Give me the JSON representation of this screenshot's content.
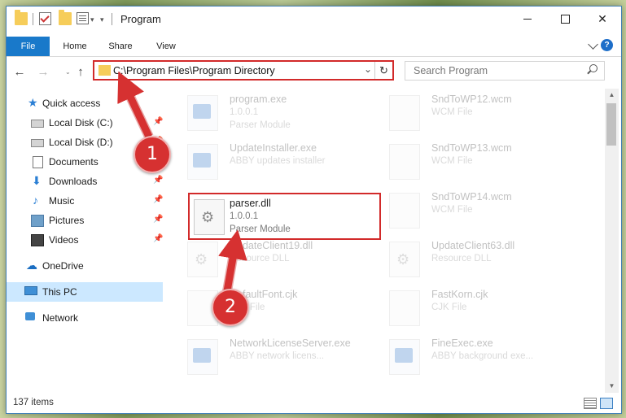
{
  "window": {
    "title": "Program"
  },
  "ribbon": {
    "tabs": [
      "File",
      "Home",
      "Share",
      "View"
    ],
    "help": "?"
  },
  "toolbar": {
    "back_icon": "←",
    "forward_icon": "→",
    "up_icon": "↑",
    "recent_icon": "⌄",
    "address": "C:\\Program Files\\Program Directory",
    "address_dropdown": "⌄",
    "refresh": "↻",
    "search_placeholder": "Search Program"
  },
  "window_controls": {
    "close": "✕"
  },
  "sidebar": {
    "items": [
      {
        "label": "Quick access",
        "icon": "star-icon",
        "glyph": "★",
        "pinned": false
      },
      {
        "label": "Local Disk (C:)",
        "icon": "drive-icon",
        "glyph": "",
        "pinned": true
      },
      {
        "label": "Local Disk (D:)",
        "icon": "drive-icon",
        "glyph": "",
        "pinned": true
      },
      {
        "label": "Documents",
        "icon": "documents-icon",
        "glyph": "",
        "pinned": true
      },
      {
        "label": "Downloads",
        "icon": "download-icon",
        "glyph": "⬇",
        "pinned": true
      },
      {
        "label": "Music",
        "icon": "music-icon",
        "glyph": "♪",
        "pinned": true
      },
      {
        "label": "Pictures",
        "icon": "pictures-icon",
        "glyph": "",
        "pinned": true
      },
      {
        "label": "Videos",
        "icon": "videos-icon",
        "glyph": "",
        "pinned": true
      },
      {
        "label": "OneDrive",
        "icon": "onedrive-icon",
        "glyph": "☁",
        "pinned": false
      },
      {
        "label": "This PC",
        "icon": "computer-icon",
        "glyph": "",
        "pinned": false,
        "selected": true
      },
      {
        "label": "Network",
        "icon": "network-icon",
        "glyph": "",
        "pinned": false
      }
    ],
    "pin_glyph": "📌"
  },
  "files": [
    {
      "name": "program.exe",
      "line1": "1.0.0.1",
      "line2": "Parser Module",
      "type": "exe",
      "faded": true
    },
    {
      "name": "SndToWP12.wcm",
      "line1": "WCM File",
      "line2": "",
      "type": "doc",
      "faded": true
    },
    {
      "name": "UpdateInstaller.exe",
      "line1": "ABBY updates installer",
      "line2": "",
      "type": "exe",
      "faded": true
    },
    {
      "name": "SndToWP13.wcm",
      "line1": "WCM File",
      "line2": "",
      "type": "doc",
      "faded": true
    },
    {
      "name": "parser.dll",
      "line1": "1.0.0.1",
      "line2": "Parser Module",
      "type": "dll",
      "faded": false
    },
    {
      "name": "SndToWP14.wcm",
      "line1": "WCM File",
      "line2": "",
      "type": "doc",
      "faded": true
    },
    {
      "name": "UpdateClient19.dll",
      "line1": "Resource DLL",
      "line2": "",
      "type": "dll",
      "faded": true
    },
    {
      "name": "UpdateClient63.dll",
      "line1": "Resource DLL",
      "line2": "",
      "type": "dll",
      "faded": true
    },
    {
      "name": "DefaultFont.cjk",
      "line1": "CJK File",
      "line2": "",
      "type": "doc",
      "faded": true
    },
    {
      "name": "FastKorn.cjk",
      "line1": "CJK File",
      "line2": "",
      "type": "doc",
      "faded": true
    },
    {
      "name": "NetworkLicenseServer.exe",
      "line1": "ABBY network licens...",
      "line2": "",
      "type": "exe",
      "faded": true
    },
    {
      "name": "FineExec.exe",
      "line1": "ABBY background exe...",
      "line2": "",
      "type": "exe",
      "faded": true
    }
  ],
  "status": {
    "items_count": "137 items"
  },
  "annotations": {
    "step1": "1",
    "step2": "2",
    "accent": "#d22a2a"
  }
}
